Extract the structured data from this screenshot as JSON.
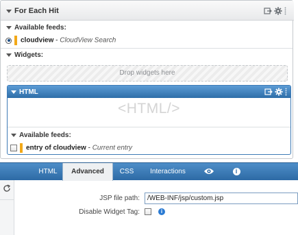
{
  "for_each_hit": {
    "title": "For Each Hit",
    "available_feeds_label": "Available feeds:",
    "feed": {
      "name": "cloudview",
      "separator": " - ",
      "description": "CloudView Search"
    },
    "widgets_label": "Widgets:",
    "drop_zone_text": "Drop widgets here"
  },
  "html_widget": {
    "title": "HTML",
    "placeholder": "<HTML/>",
    "available_feeds_label": "Available feeds:",
    "feed": {
      "name": "entry of cloudview",
      "separator": " - ",
      "description": "Current entry",
      "checked": false
    }
  },
  "editor": {
    "tabs": [
      {
        "label": "HTML",
        "active": false
      },
      {
        "label": "Advanced",
        "active": true
      },
      {
        "label": "CSS",
        "active": false
      },
      {
        "label": "Interactions",
        "active": false
      }
    ],
    "tab_icons": [
      "eye-icon",
      "info-icon"
    ],
    "jsp_path_label": "JSP file path:",
    "jsp_path_value": "/WEB-INF/jsp/custom.jsp",
    "disable_tag_label": "Disable Widget Tag:",
    "disable_tag_checked": false
  },
  "colors": {
    "accent_blue": "#2d6aa5",
    "feed_marker": "#f2a818",
    "info_blue": "#2b7bd3"
  }
}
